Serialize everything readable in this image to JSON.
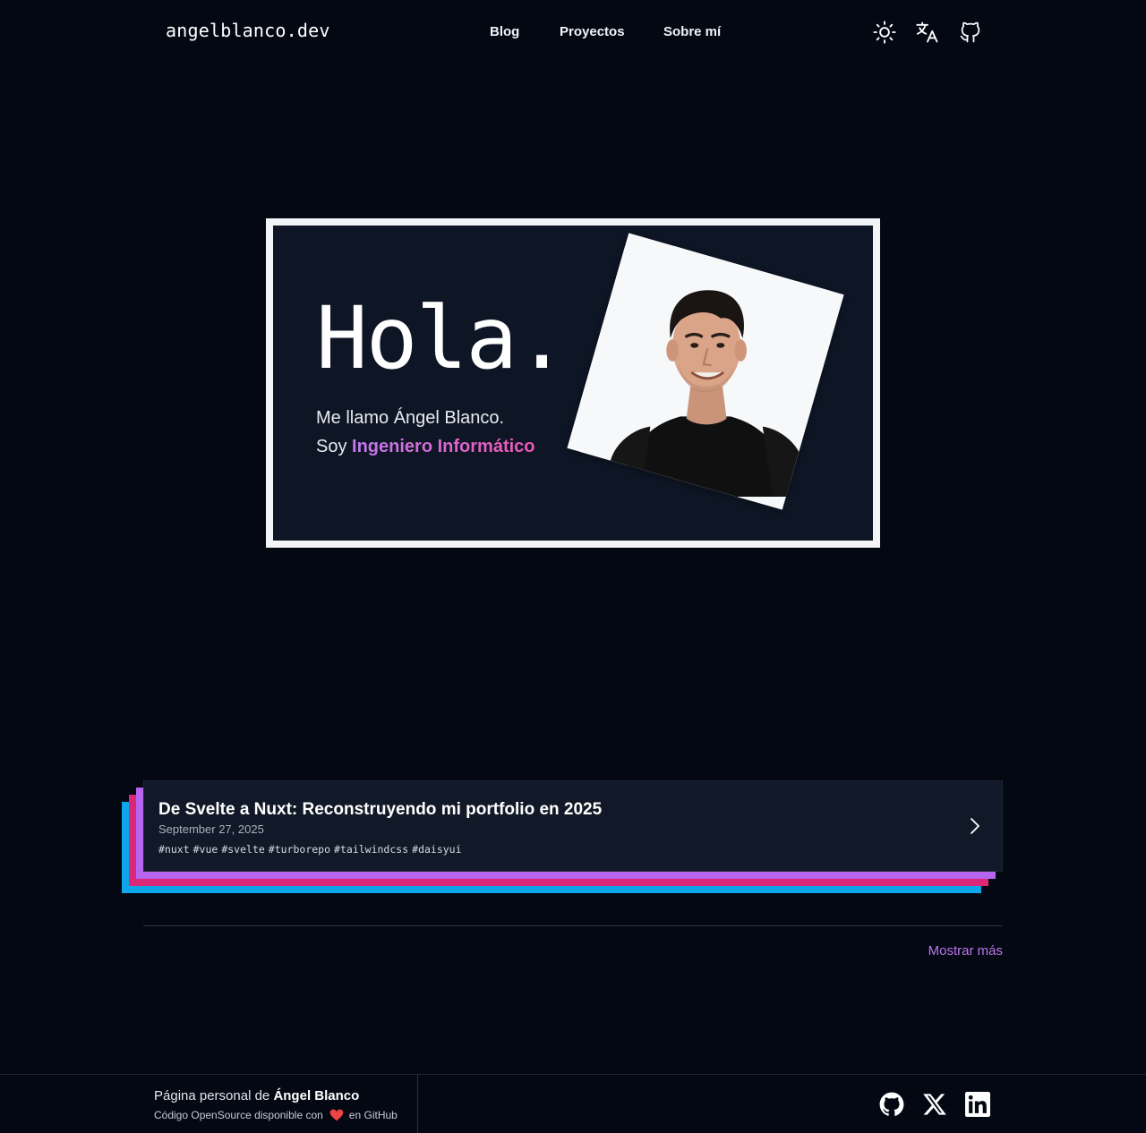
{
  "header": {
    "logo": "angelblanco.dev",
    "nav": [
      {
        "label": "Blog"
      },
      {
        "label": "Proyectos"
      },
      {
        "label": "Sobre mí"
      }
    ],
    "icons": [
      "sun-icon",
      "translate-icon",
      "github-icon"
    ]
  },
  "hero": {
    "title": "Hola.",
    "line1": "Me llamo Ángel Blanco.",
    "line2_prefix": "Soy ",
    "line2_highlight": "Ingeniero Informático"
  },
  "posts": [
    {
      "title": "De Svelte a Nuxt: Reconstruyendo mi portfolio en 2025",
      "date": "September 27, 2025",
      "tags": [
        "#nuxt",
        "#vue",
        "#svelte",
        "#turborepo",
        "#tailwindcss",
        "#daisyui"
      ]
    }
  ],
  "show_more": "Mostrar más",
  "footer": {
    "line1_prefix": "Página personal de ",
    "line1_name": "Ángel Blanco",
    "line2_prefix": "Código OpenSource disponible con",
    "line2_suffix": "en GitHub",
    "social_icons": [
      "github-icon",
      "x-icon",
      "linkedin-icon"
    ]
  },
  "colors": {
    "background": "#040813",
    "card": "#111827",
    "accent_purple": "#b977ea",
    "accent_pink": "#ef56b4",
    "layer_purple": "#a855f7",
    "layer_pink": "#ec4899",
    "layer_cyan": "#0ea5e9",
    "heart": "#ef4444"
  }
}
